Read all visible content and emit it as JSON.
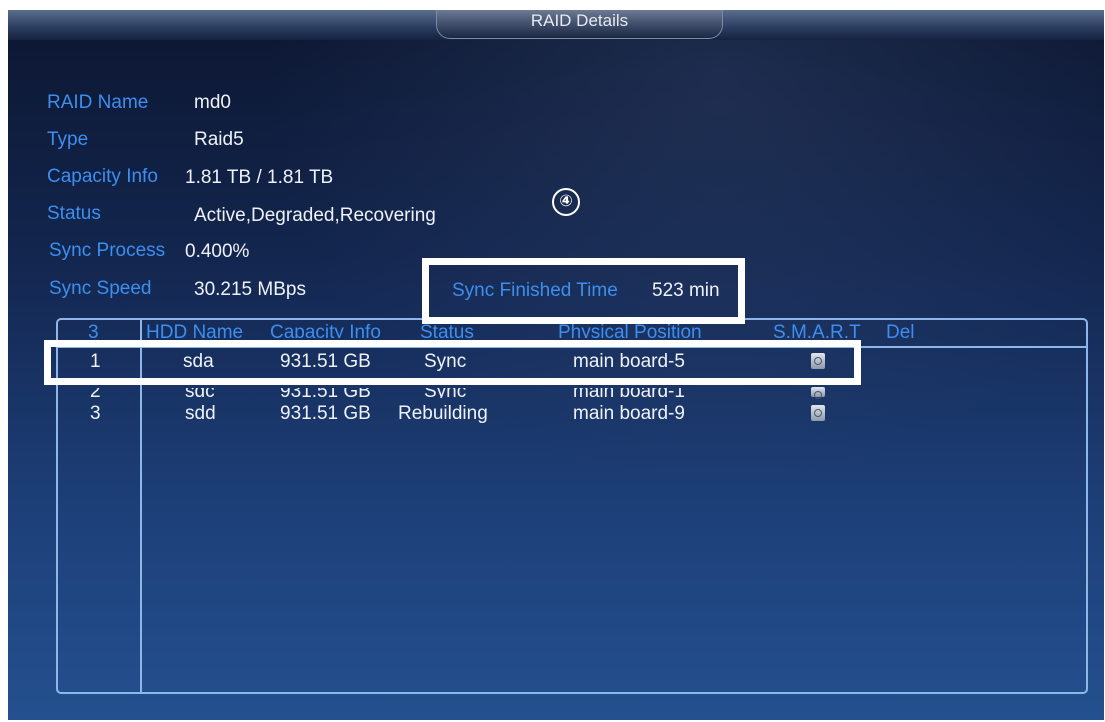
{
  "window": {
    "title": "RAID Details"
  },
  "details": {
    "raid_name": {
      "label": "RAID Name",
      "value": "md0"
    },
    "type": {
      "label": "Type",
      "value": "Raid5"
    },
    "capacity_info": {
      "label": "Capacity Info",
      "value": "1.81 TB / 1.81 TB"
    },
    "status": {
      "label": "Status",
      "value": "Active,Degraded,Recovering"
    },
    "sync_process": {
      "label": "Sync Process",
      "value": "0.400%"
    },
    "sync_speed": {
      "label": "Sync Speed",
      "value": "30.215 MBps"
    },
    "sync_finished_time": {
      "label": "Sync Finished Time",
      "value": "523 min"
    }
  },
  "annotation": {
    "step_marker": "④"
  },
  "disk_table": {
    "headers": {
      "index": "3",
      "hdd_name": "HDD Name",
      "capacity_info": "Capacity Info",
      "status": "Status",
      "physical_position": "Physical Position",
      "smart": "S.M.A.R.T",
      "del": "Del"
    },
    "rows": [
      {
        "index": "1",
        "hdd_name": "sda",
        "capacity": "931.51 GB",
        "status": "Sync",
        "position": "main board-5",
        "smart_icon": "disk-smart-icon"
      },
      {
        "index": "2",
        "hdd_name": "sdc",
        "capacity": "931.51 GB",
        "status": "Sync",
        "position": "main board-1",
        "smart_icon": "disk-smart-icon"
      },
      {
        "index": "3",
        "hdd_name": "sdd",
        "capacity": "931.51 GB",
        "status": "Rebuilding",
        "position": "main board-9",
        "smart_icon": "disk-smart-icon"
      }
    ]
  },
  "colors": {
    "label_blue": "#3c8ef0",
    "value_white": "#eef2f8",
    "highlight": "#ffffff",
    "background": "#13264f"
  }
}
